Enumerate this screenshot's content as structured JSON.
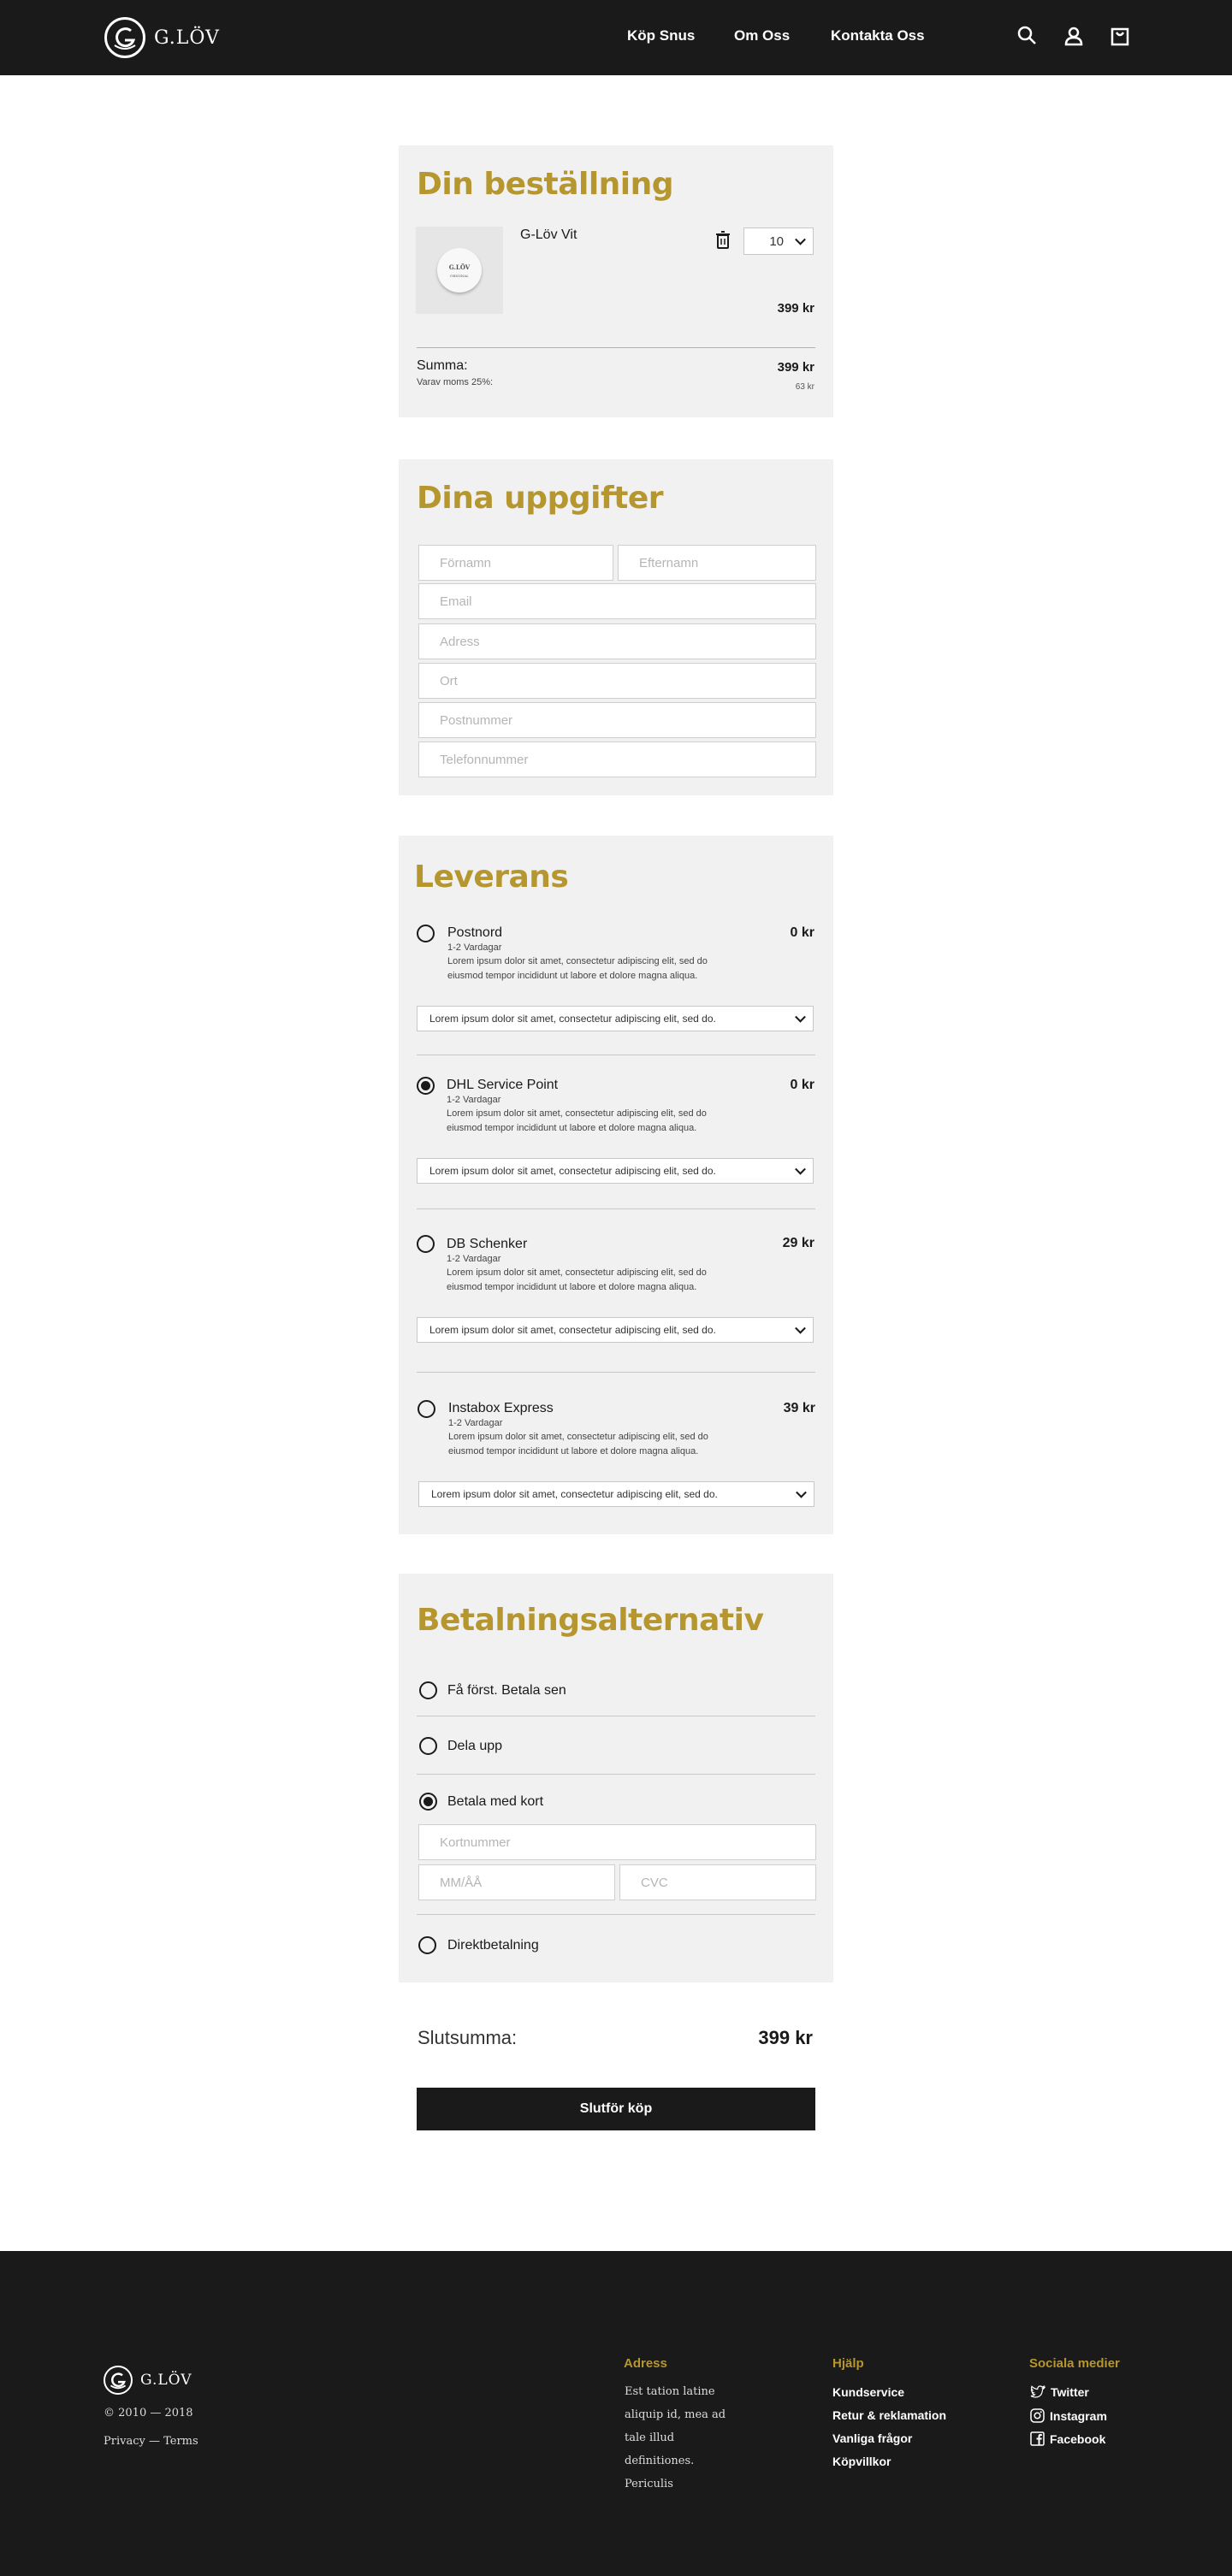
{
  "nav": {
    "brand": "G.LÖV",
    "links": [
      "Köp Snus",
      "Om Oss",
      "Kontakta Oss"
    ],
    "icons": [
      "search-icon",
      "user-icon",
      "cart-icon"
    ]
  },
  "order": {
    "title": "Din beställning",
    "item": {
      "name": "G-Löv Vit",
      "quantity": "10",
      "price": "399 kr",
      "image_brand": "G.LÖV",
      "image_label": "ORIGINAL"
    },
    "sum_label": "Summa:",
    "sum_value": "399 kr",
    "vat_label": "Varav moms 25%:",
    "vat_value": "63 kr"
  },
  "details": {
    "title": "Dina uppgifter",
    "placeholders": {
      "first_name": "Förnamn",
      "last_name": "Efternamn",
      "email": "Email",
      "address": "Adress",
      "city": "Ort",
      "postcode": "Postnummer",
      "phone": "Telefonnummer"
    }
  },
  "delivery": {
    "title": "Leverans",
    "options": [
      {
        "name": "Postnord",
        "time": "1-2 Vardagar",
        "desc": "Lorem ipsum dolor sit amet, consectetur adipiscing elit, sed do eiusmod tempor incididunt ut labore et dolore magna aliqua.",
        "price": "0 kr",
        "select": "Lorem ipsum dolor sit amet, consectetur adipiscing elit, sed do.",
        "selected": false
      },
      {
        "name": "DHL Service Point",
        "time": "1-2 Vardagar",
        "desc": "Lorem ipsum dolor sit amet, consectetur adipiscing elit, sed do eiusmod tempor incididunt ut labore et dolore magna aliqua.",
        "price": "0 kr",
        "select": "Lorem ipsum dolor sit amet, consectetur adipiscing elit, sed do.",
        "selected": true
      },
      {
        "name": "DB Schenker",
        "time": "1-2 Vardagar",
        "desc": "Lorem ipsum dolor sit amet, consectetur adipiscing elit, sed do eiusmod tempor incididunt ut labore et dolore magna aliqua.",
        "price": "29 kr",
        "select": "Lorem ipsum dolor sit amet, consectetur adipiscing elit, sed do.",
        "selected": false
      },
      {
        "name": "Instabox Express",
        "time": "1-2 Vardagar",
        "desc": "Lorem ipsum dolor sit amet, consectetur adipiscing elit, sed do eiusmod tempor incididunt ut labore et dolore magna aliqua.",
        "price": "39 kr",
        "select": "Lorem ipsum dolor sit amet, consectetur adipiscing elit, sed do.",
        "selected": false
      }
    ]
  },
  "payment": {
    "title": "Betalningsalternativ",
    "options": [
      {
        "label": "Få först. Betala sen",
        "selected": false
      },
      {
        "label": "Dela upp",
        "selected": false
      },
      {
        "label": "Betala med kort",
        "selected": true
      },
      {
        "label": "Direktbetalning",
        "selected": false
      }
    ],
    "card_number_placeholder": "Kortnummer",
    "expiry_placeholder": "MM/ÅÅ",
    "cvc_placeholder": "CVC"
  },
  "total": {
    "label": "Slutsumma:",
    "value": "399 kr"
  },
  "checkout_button": "Slutför köp",
  "footer": {
    "brand": "G.LÖV",
    "copyright": "© 2010 — 2018",
    "legal": "Privacy — Terms",
    "address_title": "Adress",
    "address_lines": [
      "Est tation latine",
      "aliquip id, mea ad",
      "tale illud",
      "definitiones.",
      "Periculis"
    ],
    "help_title": "Hjälp",
    "help_links": [
      "Kundservice",
      "Retur & reklamation",
      "Vanliga frågor",
      "Köpvillkor"
    ],
    "social_title": "Sociala medier",
    "social_links": [
      "Twitter",
      "Instagram",
      "Facebook"
    ]
  },
  "colors": {
    "accent": "#b5962f",
    "dark": "#1a1a1a",
    "panel": "#f1f1f1"
  }
}
